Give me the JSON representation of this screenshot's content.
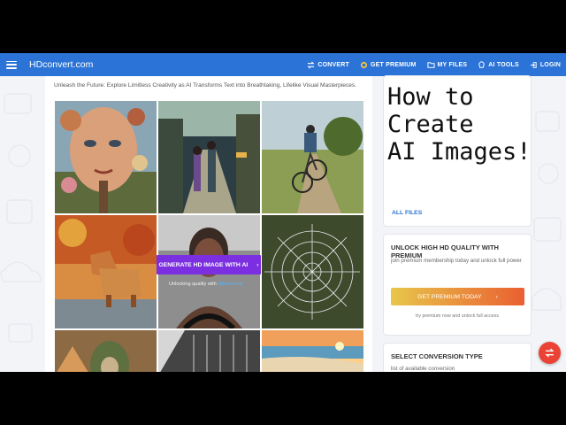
{
  "app": {
    "brand": "HDconvert.com"
  },
  "nav": [
    {
      "label": "CONVERT",
      "icon": "convert-icon"
    },
    {
      "label": "GET PREMIUM",
      "icon": "premium-icon"
    },
    {
      "label": "MY FILES",
      "icon": "folder-icon"
    },
    {
      "label": "AI TOOLS",
      "icon": "ai-tools-icon"
    },
    {
      "label": "LOGIN",
      "icon": "login-icon"
    }
  ],
  "main": {
    "tagline": "Unleash the Future: Explore Limitless Creativity as AI Transforms Text into Breathtaking, Lifelike Visual Masterpieces.",
    "cta_label": "GENERATE HD IMAGE WITH AI",
    "cta_note_prefix": "Unlocking quality with",
    "cta_note_brand": "HDconvert",
    "gallery": [
      "surreal-face-artwork",
      "anime-street-couple",
      "cyclist-country-road",
      "origami-lion-autumn",
      "woman-portrait",
      "spider-web",
      "hooded-figure",
      "concrete-building",
      "beach-sunset"
    ]
  },
  "sidebar": {
    "card1": {
      "title": "How to\nCreate\nAI Images!",
      "link": "ALL FILES"
    },
    "card2": {
      "title": "UNLOCK HIGH HD QUALITY WITH PREMIUM",
      "desc": "join premium membership today and unlock full power",
      "button": "GET PREMIUM TODAY",
      "note": "try premium now and unlock full access"
    },
    "card3": {
      "title": "SELECT CONVERSION TYPE",
      "desc": "list of available conversion"
    }
  },
  "colors": {
    "topbar": "#2b73d6",
    "cta": "#7b2fe0",
    "fab": "#ea4336"
  }
}
